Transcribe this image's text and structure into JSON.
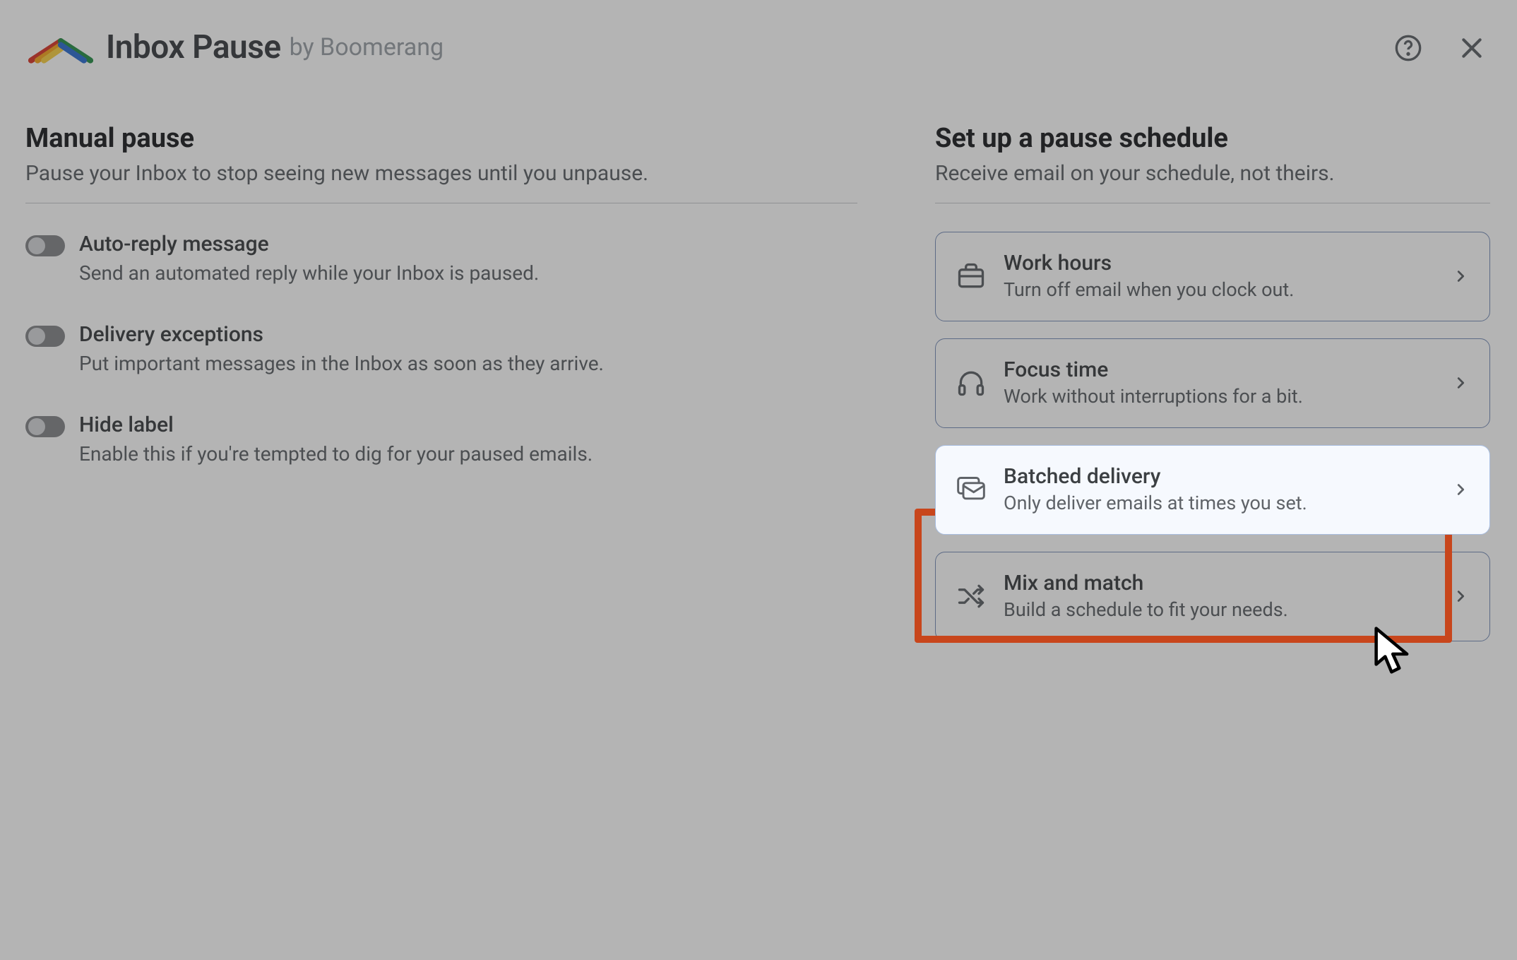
{
  "header": {
    "title": "Inbox Pause",
    "subtitle": "by Boomerang"
  },
  "left": {
    "title": "Manual pause",
    "subtitle": "Pause your Inbox to stop seeing new messages until you unpause.",
    "toggles": [
      {
        "title": "Auto-reply message",
        "desc": "Send an automated reply while your Inbox is paused."
      },
      {
        "title": "Delivery exceptions",
        "desc": "Put important messages in the Inbox as soon as they arrive."
      },
      {
        "title": "Hide label",
        "desc": "Enable this if you're tempted to dig for your paused emails."
      }
    ]
  },
  "right": {
    "title": "Set up a pause schedule",
    "subtitle": "Receive email on your schedule, not theirs.",
    "cards": [
      {
        "title": "Work hours",
        "desc": "Turn off email when you clock out."
      },
      {
        "title": "Focus time",
        "desc": "Work without interruptions for a bit."
      },
      {
        "title": "Batched delivery",
        "desc": "Only deliver emails at times you set."
      },
      {
        "title": "Mix and match",
        "desc": "Build a schedule to fit your needs."
      }
    ]
  }
}
